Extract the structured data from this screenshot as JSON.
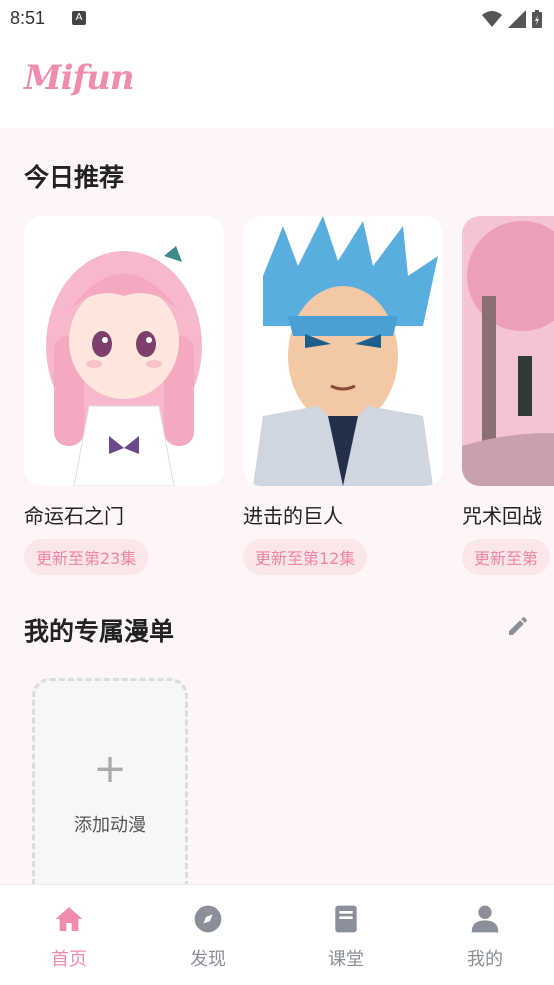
{
  "status_bar": {
    "time": "8:51"
  },
  "header": {
    "logo": "Mifun"
  },
  "recommend": {
    "title": "今日推荐",
    "items": [
      {
        "title": "命运石之门",
        "badge": "更新至第23集"
      },
      {
        "title": "进击的巨人",
        "badge": "更新至第12集"
      },
      {
        "title": "咒术回战",
        "badge": "更新至第"
      }
    ]
  },
  "my_list": {
    "title": "我的专属漫单",
    "add_label": "添加动漫"
  },
  "tabs": [
    {
      "label": "首页",
      "icon": "home-icon",
      "active": true
    },
    {
      "label": "发现",
      "icon": "compass-icon",
      "active": false
    },
    {
      "label": "课堂",
      "icon": "book-icon",
      "active": false
    },
    {
      "label": "我的",
      "icon": "person-icon",
      "active": false
    }
  ],
  "colors": {
    "accent": "#f08cac",
    "inactive": "#8a8f99",
    "background": "#fdf5f6"
  }
}
